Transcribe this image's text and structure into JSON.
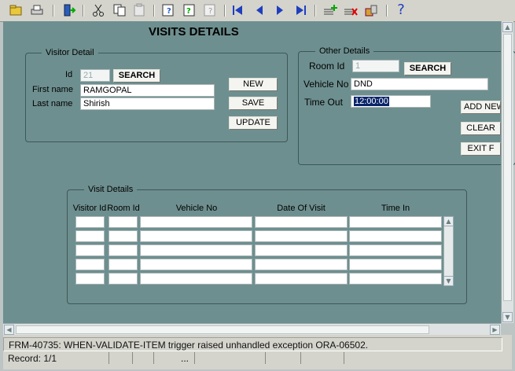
{
  "toolbar": {
    "icons": [
      "save-icon",
      "print-icon",
      "exit-icon",
      "cut-icon",
      "copy-icon",
      "paste-icon",
      "query-enter-icon",
      "query-execute-icon",
      "query-cancel-icon",
      "first-record-icon",
      "previous-record-icon",
      "next-record-icon",
      "last-record-icon",
      "insert-record-icon",
      "delete-record-icon",
      "lock-record-icon",
      "help-icon"
    ],
    "help_glyph": "?"
  },
  "form": {
    "title": "VISITS DETAILS",
    "visitor_detail": {
      "group_label": "Visitor Detail",
      "id_label": "Id",
      "id_value": "21",
      "first_name_label": "First name",
      "first_name_value": "RAMGOPAL",
      "last_name_label": "Last name",
      "last_name_value": "Shirish",
      "search_label": "SEARCH",
      "new_label": "NEW",
      "save_label": "SAVE",
      "update_label": "UPDATE"
    },
    "other_details": {
      "group_label": "Other Details",
      "room_id_label": "Room Id",
      "room_id_value": "1",
      "search_label": "SEARCH",
      "vehicle_no_label": "Vehicle No",
      "vehicle_no_value": "DND",
      "time_out_label": "Time Out",
      "time_out_value": "12:00:00",
      "add_new_label": "ADD NEW",
      "clear_label": "CLEAR",
      "exit_label": "EXIT F"
    },
    "visit_details": {
      "group_label": "Visit Details",
      "columns": [
        "Visitor Id",
        "Room Id",
        "Vehicle No",
        "Date Of Visit",
        "Time In"
      ],
      "row_count": 5
    }
  },
  "status": {
    "message": "FRM-40735: WHEN-VALIDATE-ITEM trigger raised unhandled exception ORA-06502.",
    "record": "Record: 1/1",
    "ellipsis": "..."
  },
  "colors": {
    "canvas": "#6e8f8f",
    "selection": "#0a246a",
    "toolbar": "#d4d4cc"
  }
}
